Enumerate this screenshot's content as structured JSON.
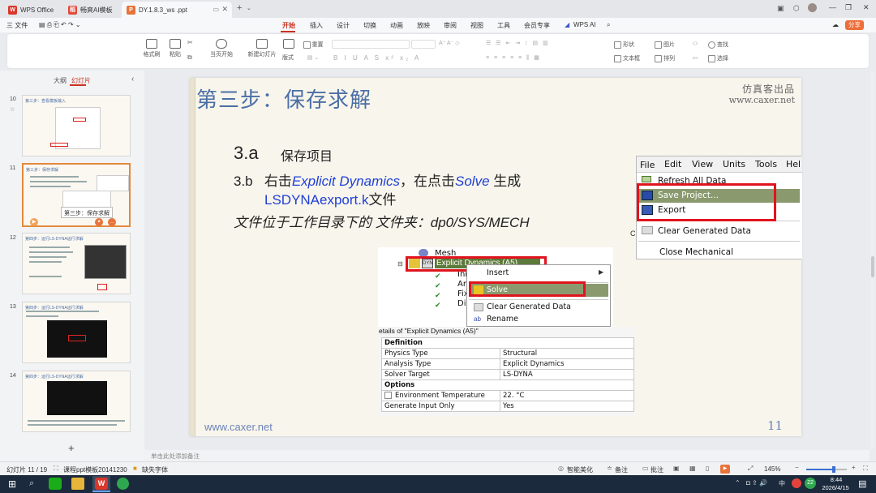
{
  "tabs": [
    {
      "label": "WPS Office"
    },
    {
      "label": "畅爽AI模板"
    },
    {
      "label": "DY.1.8.3_ws .ppt"
    }
  ],
  "menu": {
    "file": "三 文件",
    "items": [
      "开始",
      "插入",
      "设计",
      "切换",
      "动画",
      "放映",
      "审阅",
      "视图",
      "工具",
      "会员专享"
    ],
    "wps_ai": "WPS AI",
    "share": "分享"
  },
  "ribbon": {
    "format_painter": "格式刷",
    "paste": "粘贴",
    "play_from_current": "当页开始",
    "new_slide": "新建幻灯片",
    "layout": "版式",
    "reset": "重置",
    "shape": "形状",
    "picture": "图片",
    "textbox": "文本框",
    "arrange": "排列",
    "find": "查找",
    "select": "选择"
  },
  "left": {
    "tab_outline": "大纲",
    "tab_slides": "幻灯片",
    "slides": [
      {
        "num": "10",
        "title": "第三步：查看模板输入",
        "caption": ""
      },
      {
        "num": "11",
        "title": "第三步：保存求解",
        "caption": ""
      },
      {
        "num": "12",
        "title": "第四步：运行LS-DYNA运行求解",
        "caption": ""
      },
      {
        "num": "13",
        "title": "第四步：运行LS-DYNA运行求解",
        "caption": ""
      },
      {
        "num": "14",
        "title": "第四步：运行LS-DYNA运行求解",
        "caption": ""
      }
    ],
    "tooltip": "第三步：保存求解",
    "add": "+"
  },
  "slide": {
    "title": "第三步：保存求解",
    "brand_cn": "仿真客出品",
    "brand_url": "www.caxer.net",
    "line_a_num": "3.a",
    "line_a_text": "保存项目",
    "line_b_num": "3.b",
    "line_b_pre": "右击",
    "line_b_ed": "Explicit Dynamics",
    "line_b_mid": "，在点击",
    "line_b_solve": "Solve",
    "line_b_post": "生成",
    "line_b2_file": "LSDYNAexport.k",
    "line_b2_post": "文件",
    "line_c_pre": "文件位于工作目录下的 文件夹：",
    "line_c_path": "dp0/SYS/MECH",
    "footer_url": "www.caxer.net",
    "page_num": "11",
    "file_menu": {
      "menus": [
        "File",
        "Edit",
        "View",
        "Units",
        "Tools",
        "Hel"
      ],
      "items": [
        "Refresh All Data",
        "Save Project...",
        "Export",
        "Clear Generated Data",
        "Close Mechanical"
      ]
    },
    "tree": {
      "mesh": "Mesh",
      "ed": "Explicit Dynamics (A5)",
      "children": [
        "Ini",
        "An",
        "Fix",
        "Dis"
      ]
    },
    "context_menu": {
      "items": [
        "Insert",
        "Solve",
        "Clear Generated Data",
        "Rename"
      ]
    },
    "details": {
      "header": "etails of \"Explicit Dynamics (A5)\"",
      "sec1": "Definition",
      "rows1": [
        [
          "Physics Type",
          "Structural"
        ],
        [
          "Analysis Type",
          "Explicit Dynamics"
        ],
        [
          "Solver Target",
          "LS-DYNA"
        ]
      ],
      "sec2": "Options",
      "rows2": [
        [
          "Environment Temperature",
          "22. °C"
        ],
        [
          "Generate Input Only",
          "Yes"
        ]
      ]
    }
  },
  "notes_placeholder": "单击此处添加备注",
  "status": {
    "slide_info": "幻灯片 11 / 19",
    "template": "课程ppt模板20141230",
    "font_missing": "缺失字体",
    "beautify": "智能美化",
    "notes": "备注",
    "comments": "批注",
    "zoom": "145%"
  },
  "taskbar": {
    "time": "8:44",
    "date": "2026/4/15",
    "lang": "中",
    "badge": "22"
  }
}
